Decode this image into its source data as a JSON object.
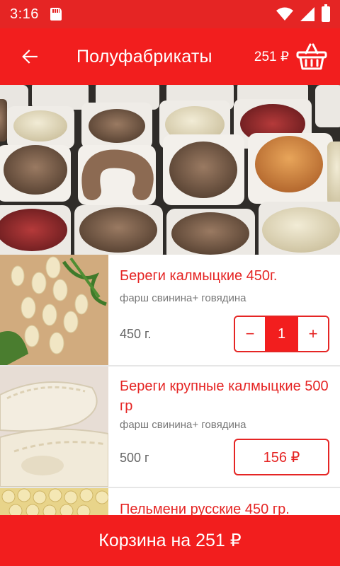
{
  "status_bar": {
    "time": "3:16"
  },
  "app_bar": {
    "title": "Полуфабрикаты",
    "cart_total": "251 ₽"
  },
  "products": [
    {
      "name": "Береги калмыцкие 450г.",
      "description": "фарш свинина+ говядина",
      "weight": "450 г.",
      "quantity": "1",
      "minus": "−",
      "plus": "+"
    },
    {
      "name": "Береги крупные калмыцкие 500 гр",
      "description": "фарш свинина+ говядина",
      "weight": "500 г",
      "price": "156 ₽"
    },
    {
      "name": "Пельмени русские 450 гр."
    }
  ],
  "bottom_bar": {
    "label": "Корзина на 251 ₽"
  },
  "colors": {
    "primary": "#f21e1e",
    "status_bar": "#e52524",
    "accent_text": "#e52524"
  }
}
